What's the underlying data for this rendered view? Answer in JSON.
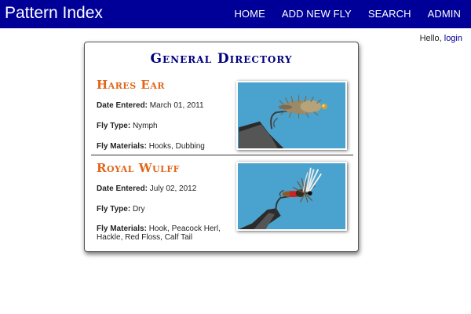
{
  "navbar": {
    "brand": "Pattern Index",
    "links": [
      {
        "label": "HOME"
      },
      {
        "label": "ADD NEW FLY"
      },
      {
        "label": "SEARCH"
      },
      {
        "label": "ADMIN"
      }
    ]
  },
  "greeting": {
    "hello": "Hello,",
    "login": "login"
  },
  "directory": {
    "title": "General Directory",
    "entries": [
      {
        "name": "Hares Ear",
        "date_label": "Date Entered:",
        "date": "March 01, 2011",
        "type_label": "Fly Type:",
        "type": "Nymph",
        "materials_label": "Fly Materials:",
        "materials": "Hooks, Dubbing",
        "image_icon": "hares-ear-fly-photo"
      },
      {
        "name": "Royal Wulff",
        "date_label": "Date Entered:",
        "date": "July 02, 2012",
        "type_label": "Fly Type:",
        "type": "Dry",
        "materials_label": "Fly Materials:",
        "materials": "Hook, Peacock Herl, Hackle, Red Floss, Calf Tail",
        "image_icon": "royal-wulff-fly-photo"
      }
    ]
  },
  "colors": {
    "navbar": "#000099",
    "title": "#000080",
    "fly_name": "#e0661a",
    "photo_background": "#4aa3cf"
  }
}
